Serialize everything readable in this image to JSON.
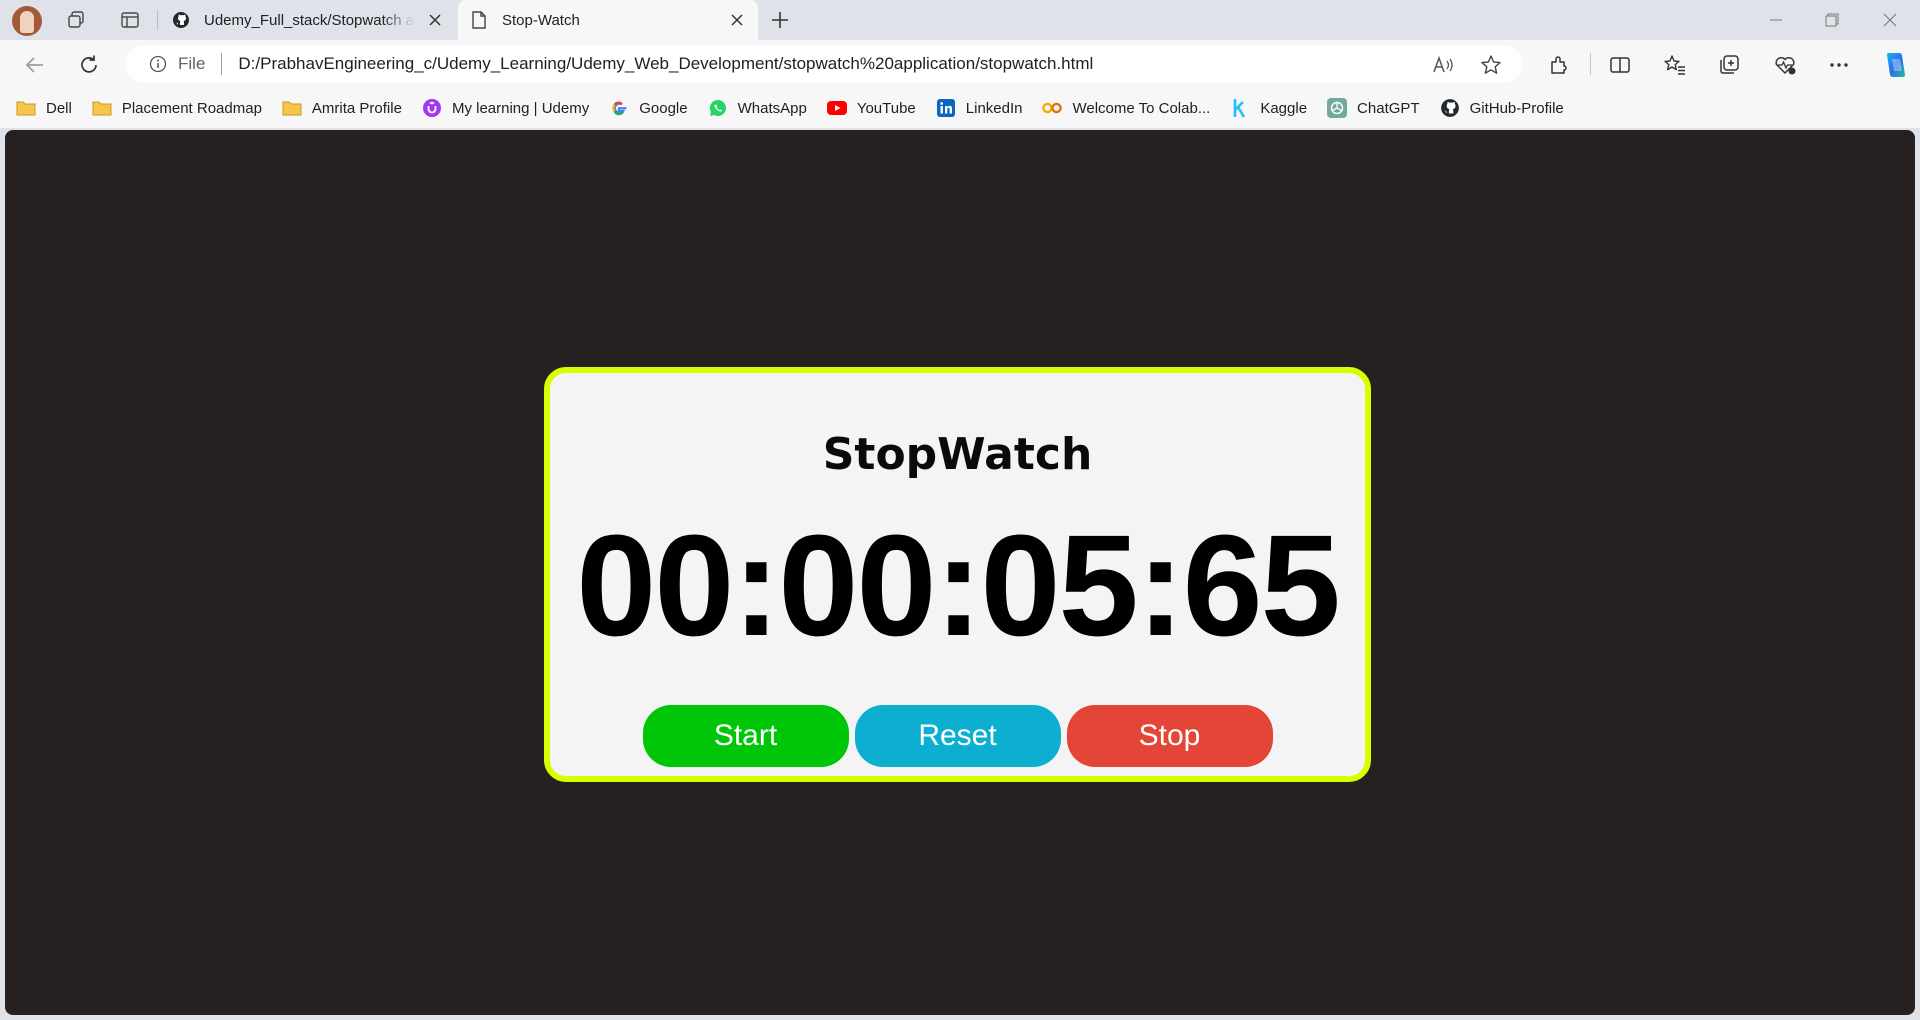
{
  "browser": {
    "tabs": [
      {
        "title": "Udemy_Full_stack/Stopwatch at main",
        "active": false,
        "icon": "github-icon"
      },
      {
        "title": "Stop-Watch",
        "active": true,
        "icon": "page-icon"
      }
    ],
    "address_bar": {
      "scheme_label": "File",
      "url": "D:/PrabhavEngineering_c/Udemy_Learning/Udemy_Web_Development/stopwatch%20application/stopwatch.html"
    },
    "bookmarks": [
      {
        "label": "Dell",
        "icon": "folder-icon"
      },
      {
        "label": "Placement Roadmap",
        "icon": "folder-icon"
      },
      {
        "label": "Amrita Profile",
        "icon": "folder-icon"
      },
      {
        "label": "My learning | Udemy",
        "icon": "udemy-icon"
      },
      {
        "label": "Google",
        "icon": "google-icon"
      },
      {
        "label": "WhatsApp",
        "icon": "whatsapp-icon"
      },
      {
        "label": "YouTube",
        "icon": "youtube-icon"
      },
      {
        "label": "LinkedIn",
        "icon": "linkedin-icon"
      },
      {
        "label": "Welcome To Colab...",
        "icon": "colab-icon"
      },
      {
        "label": "Kaggle",
        "icon": "kaggle-icon"
      },
      {
        "label": "ChatGPT",
        "icon": "chatgpt-icon"
      },
      {
        "label": "GitHub-Profile",
        "icon": "github-icon"
      }
    ]
  },
  "page": {
    "background_color": "#272020",
    "card": {
      "border_color": "#d7ff00",
      "title": "StopWatch",
      "time": "00:00:05:65"
    },
    "buttons": {
      "start": {
        "label": "Start",
        "color": "#00c60a"
      },
      "reset": {
        "label": "Reset",
        "color": "#0cafd0"
      },
      "stop": {
        "label": "Stop",
        "color": "#e34636"
      }
    }
  }
}
